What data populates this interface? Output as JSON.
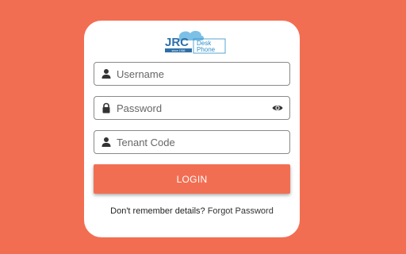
{
  "logo": {
    "brand": "JRC",
    "line1": "Desk",
    "line2": "Phone",
    "tagline": "since 1966"
  },
  "form": {
    "username_placeholder": "Username",
    "password_placeholder": "Password",
    "tenant_placeholder": "Tenant Code",
    "login_label": "LOGIN"
  },
  "footer": {
    "prompt": "Don't remember details?",
    "link": "Forgot Password"
  },
  "colors": {
    "background": "#F26E52",
    "accent": "#F26E52",
    "logo_blue": "#2E8FC9"
  },
  "icons": {
    "username": "person-icon",
    "password": "lock-icon",
    "toggle": "eye-icon",
    "tenant": "person-icon"
  }
}
